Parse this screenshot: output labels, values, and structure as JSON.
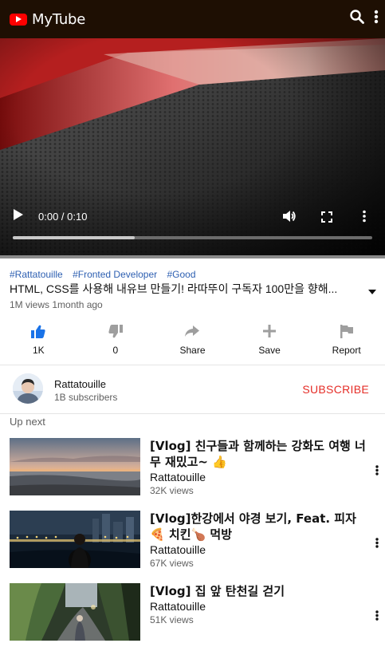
{
  "app": {
    "title": "MyTube"
  },
  "player": {
    "time": "0:00 / 0:10",
    "progress_fraction": 0.34
  },
  "video": {
    "tags": [
      "#Rattatouille",
      "#Fronted Developer",
      "#Good"
    ],
    "title": "HTML, CSS를 사용해 내유브 만들기! 라따뚜이 구독자 100만을 향해...",
    "meta": "1M views 1month ago"
  },
  "actions": [
    {
      "id": "like",
      "label": "1K",
      "icon": "thumbs-up-icon",
      "color": "#1a73e8"
    },
    {
      "id": "dislike",
      "label": "0",
      "icon": "thumbs-down-icon",
      "color": "#9e9e9e"
    },
    {
      "id": "share",
      "label": "Share",
      "icon": "share-icon",
      "color": "#9e9e9e"
    },
    {
      "id": "save",
      "label": "Save",
      "icon": "plus-icon",
      "color": "#9e9e9e"
    },
    {
      "id": "report",
      "label": "Report",
      "icon": "flag-icon",
      "color": "#9e9e9e"
    }
  ],
  "channel": {
    "name": "Rattatouille",
    "subscribers": "1B subscribers",
    "subscribe_label": "SUBSCRIBE"
  },
  "up_next": {
    "label": "Up next",
    "items": [
      {
        "title": "[Vlog] 친구들과 함께하는 강화도 여행 너무 재밌고~ 👍",
        "channel": "Rattatouille",
        "views": "32K views"
      },
      {
        "title": "[Vlog]한강에서 야경 보기, Feat. 피자🍕 치킨🍗 먹방",
        "channel": "Rattatouille",
        "views": "67K views"
      },
      {
        "title": "[Vlog] 집 앞 탄천길 걷기",
        "channel": "Rattatouille",
        "views": "51K views"
      }
    ]
  },
  "colors": {
    "header_bg": "#1e0f03",
    "brand_red": "#ff0000",
    "tag_blue": "#2d5fb1",
    "subscribe_red": "#e52d27"
  }
}
